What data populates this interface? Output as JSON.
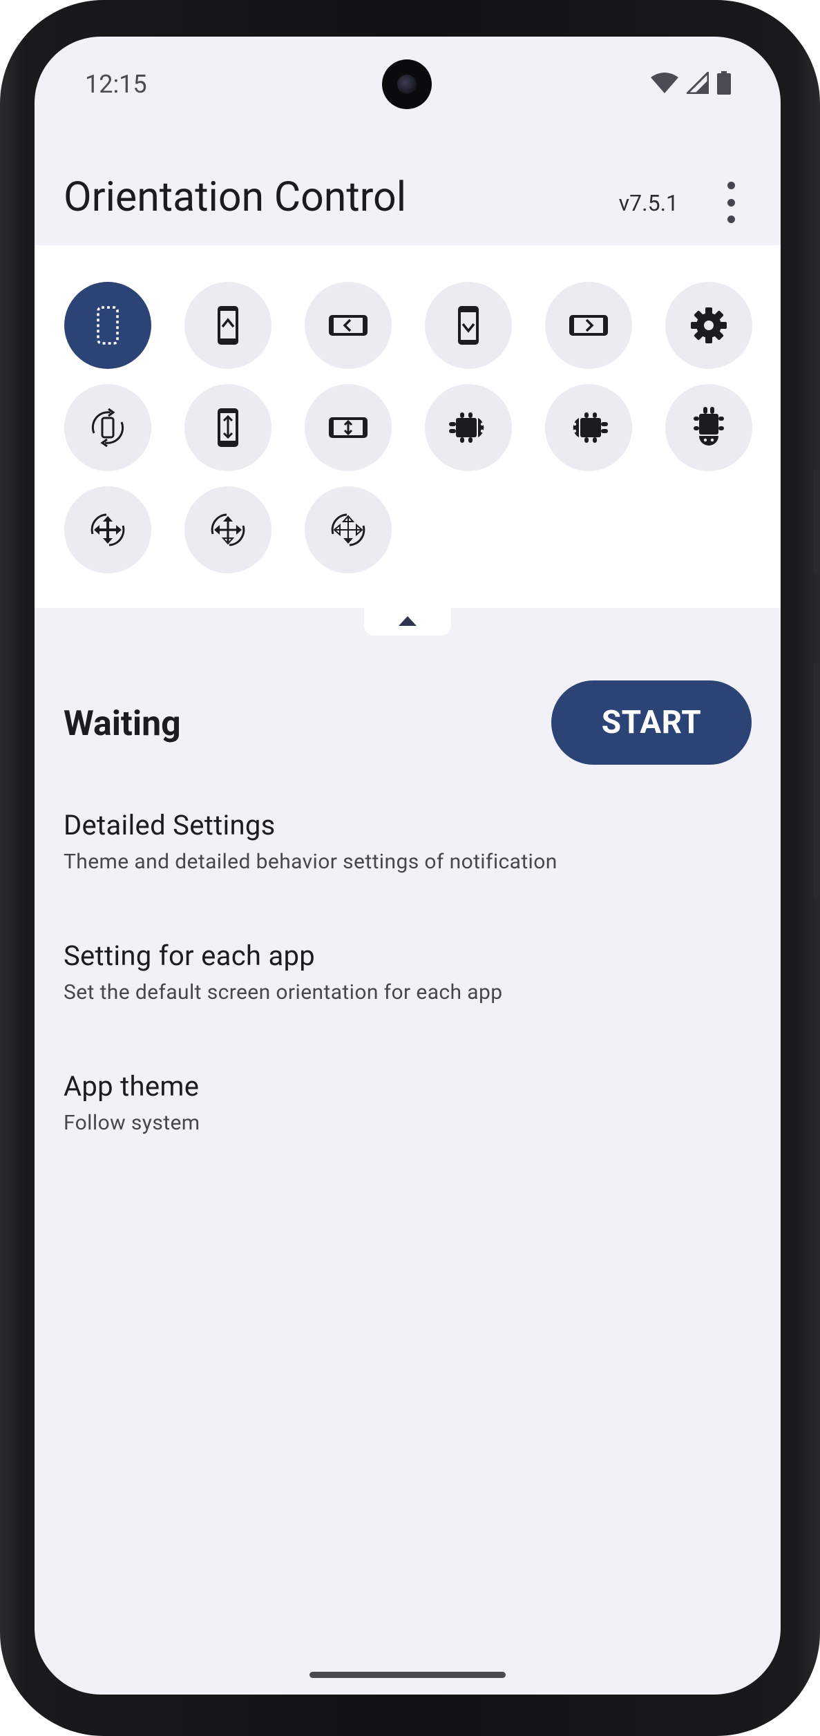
{
  "status_bar": {
    "time": "12:15",
    "icons": [
      "wifi-icon",
      "cell-signal-icon",
      "battery-icon"
    ]
  },
  "app_bar": {
    "title": "Orientation Control",
    "version": "v7.5.1",
    "menu_icon": "more-vert-icon"
  },
  "orientation_buttons": [
    {
      "name": "unspecified-icon",
      "selected": true
    },
    {
      "name": "portrait-icon",
      "selected": false
    },
    {
      "name": "landscape-icon",
      "selected": false
    },
    {
      "name": "reverse-portrait-icon",
      "selected": false
    },
    {
      "name": "reverse-landscape-icon",
      "selected": false
    },
    {
      "name": "settings-gear-icon",
      "selected": false
    },
    {
      "name": "auto-rotate-icon",
      "selected": false
    },
    {
      "name": "sensor-portrait-icon",
      "selected": false
    },
    {
      "name": "sensor-landscape-icon",
      "selected": false
    },
    {
      "name": "android-landscape-icon",
      "selected": false
    },
    {
      "name": "android-reverse-landscape-icon",
      "selected": false
    },
    {
      "name": "android-reverse-portrait-icon",
      "selected": false
    },
    {
      "name": "full-sensor-icon",
      "selected": false
    },
    {
      "name": "full-sensor-variant-icon",
      "selected": false
    },
    {
      "name": "full-sensor-outline-icon",
      "selected": false
    }
  ],
  "colors": {
    "accent": "#2b4375",
    "background": "#f2f1f7",
    "panel": "#ffffff",
    "chip": "#ecebf1",
    "icon": "#1b1b21"
  },
  "service": {
    "status": "Waiting",
    "start_label": "START"
  },
  "settings": [
    {
      "title": "Detailed Settings",
      "subtitle": "Theme and detailed behavior settings of notification"
    },
    {
      "title": "Setting for each app",
      "subtitle": "Set the default screen orientation for each app"
    },
    {
      "title": "App theme",
      "subtitle": "Follow system"
    }
  ]
}
